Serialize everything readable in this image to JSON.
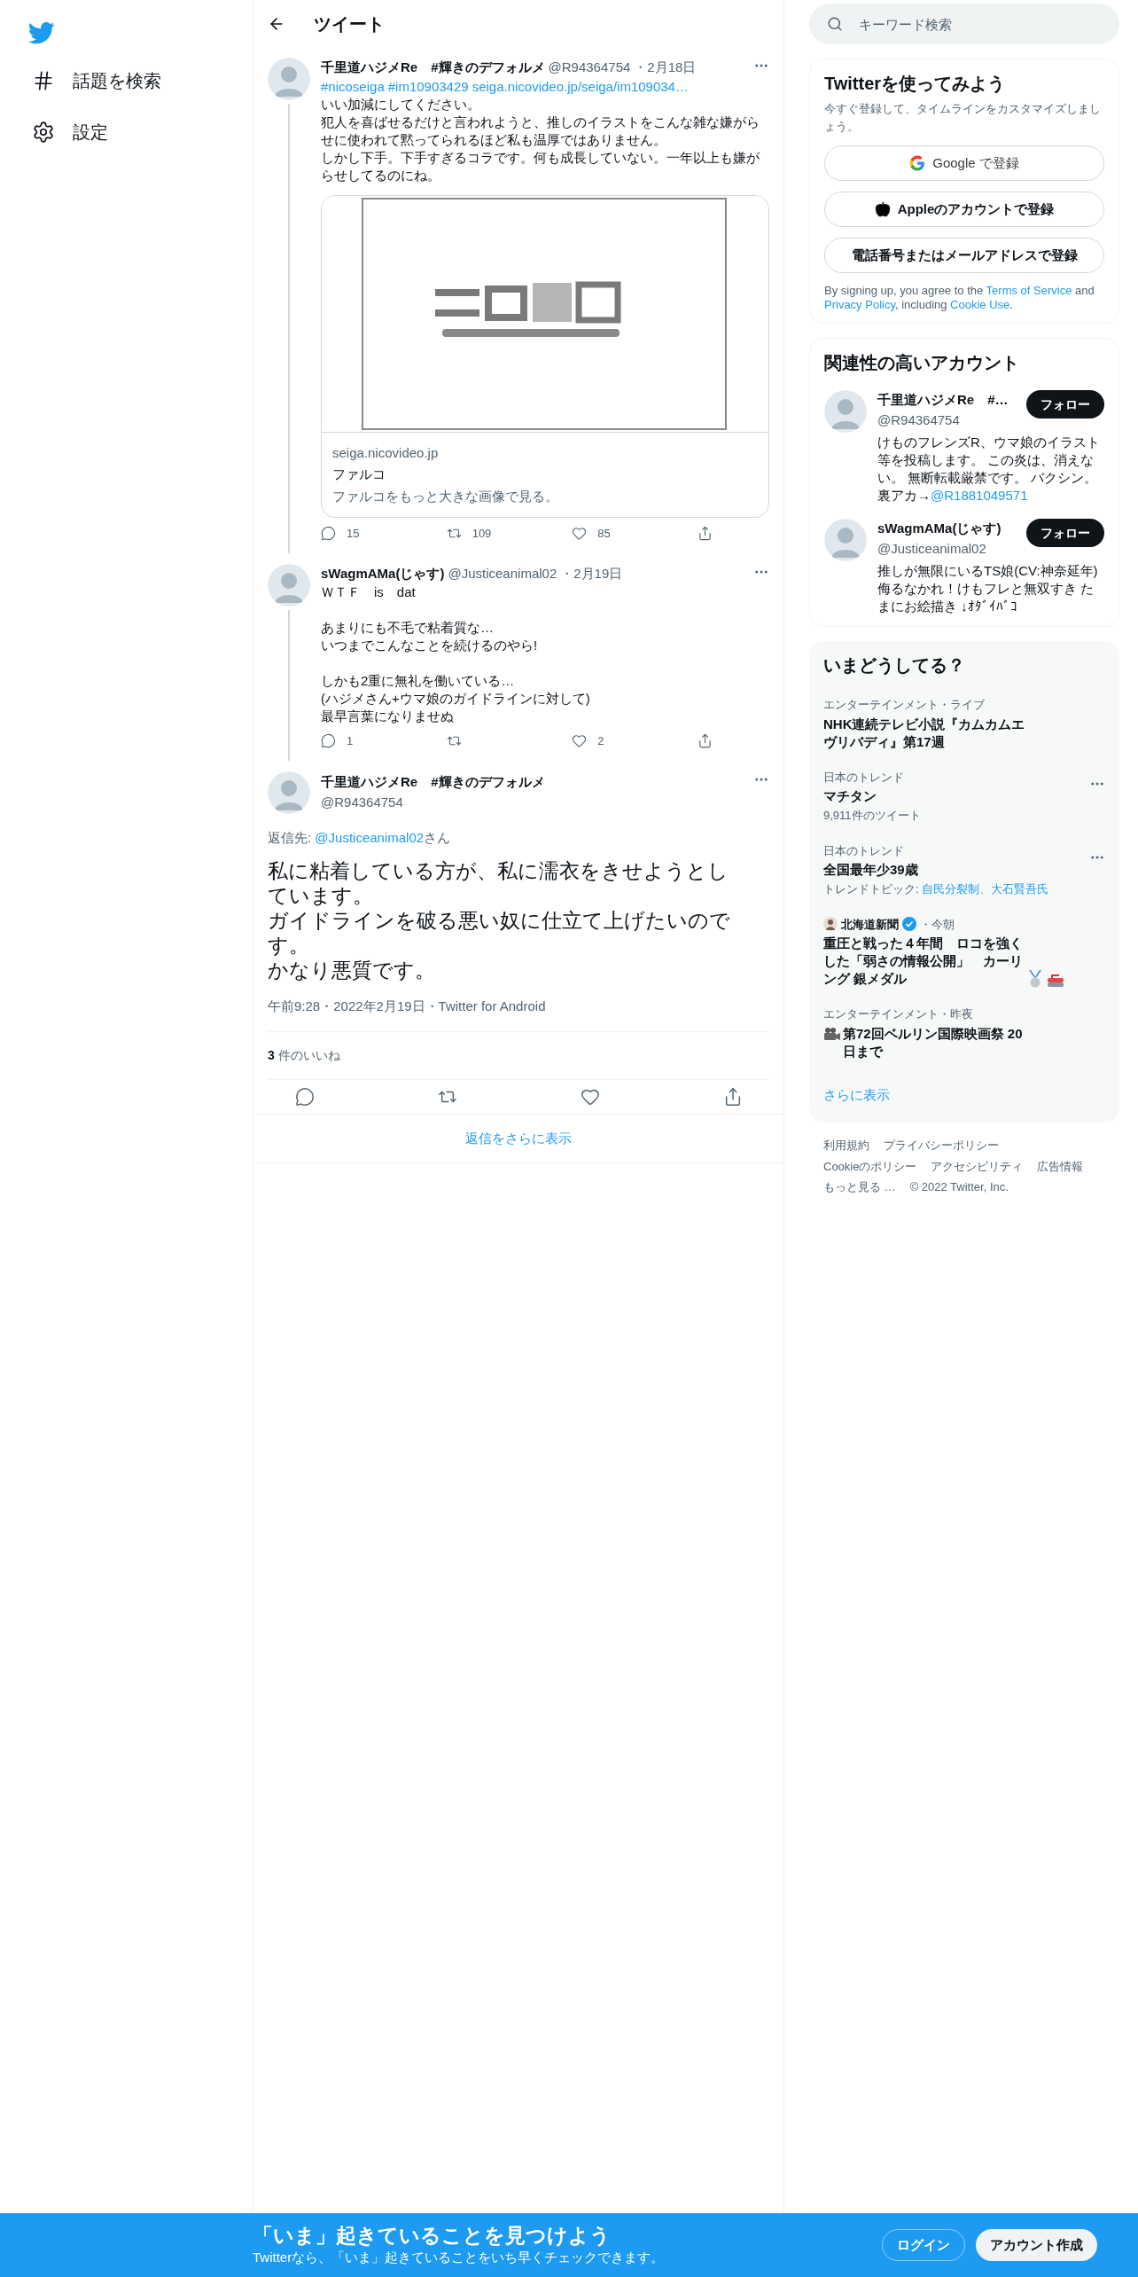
{
  "nav": {
    "items": [
      {
        "label": "話題を検索",
        "kind": "explore"
      },
      {
        "label": "設定",
        "kind": "settings"
      }
    ]
  },
  "header": {
    "title": "ツイート"
  },
  "thread": [
    {
      "name": "千里道ハジメRe　#輝きのデフォルメ",
      "handle": "@R94364754",
      "date": "・2月18日",
      "links": [
        "#nicoseiga",
        "#im10903429",
        "seiga.nicovideo.jp/seiga/im109034…"
      ],
      "paragraphs": [
        [
          "いい加減にしてください。",
          "犯人を喜ばせるだけと言われようと、推しのイラストをこんな雑な嫌がらせに使われて黙ってられるほど私も温厚ではありません。",
          "しかし下手。下手すぎるコラです。何も成長していない。一年以上も嫌がらせしてるのにね。"
        ]
      ],
      "card": {
        "domain": "seiga.nicovideo.jp",
        "title": "ファルコ",
        "description": "ファルコをもっと大きな画像で見る。"
      },
      "replies": "15",
      "retweets": "109",
      "likes": "85"
    },
    {
      "name": "sWagmAMa(じゃす)",
      "handle": "@Justiceanimal02",
      "date": "・2月19日",
      "paragraphs": [
        [
          "ＷＴＦ　is　dat"
        ],
        [
          "あまりにも不毛で粘着質な…",
          "いつまでこんなことを続けるのやら!"
        ],
        [
          "しかも2重に無礼を働いている…",
          "(ハジメさん+ウマ娘のガイドラインに対して)",
          "最早言葉になりませぬ"
        ]
      ],
      "replies": "1",
      "likes": "2"
    }
  ],
  "main_tweet": {
    "name": "千里道ハジメRe　#輝きのデフォルメ",
    "handle": "@R94364754",
    "reply_prefix": "返信先: ",
    "reply_to": "@Justiceanimal02",
    "reply_suffix": "さん",
    "lines": [
      "私に粘着している方が、私に濡衣をきせようとしています。",
      "ガイドラインを破る悪い奴に仕立て上げたいのです。",
      "かなり悪質です。"
    ],
    "meta": "午前9:28・2022年2月19日・Twitter for Android",
    "like_count": "3",
    "like_label": "件のいいね"
  },
  "show_more_replies": "返信をさらに表示",
  "search": {
    "placeholder": "キーワード検索"
  },
  "signup": {
    "title": "Twitterを使ってみよう",
    "subtitle": "今すぐ登録して、タイムラインをカスタマイズしましょう。",
    "buttons": [
      {
        "label": "Google で登録",
        "kind": "google"
      },
      {
        "label": "Appleのアカウントで登録",
        "kind": "apple"
      },
      {
        "label": "電話番号またはメールアドレスで登録",
        "kind": "plain"
      }
    ],
    "legal": [
      "By signing up, you agree to the ",
      "Terms of Service",
      " and ",
      "Privacy Policy",
      ", including ",
      "Cookie Use",
      "."
    ]
  },
  "related": {
    "title": "関連性の高いアカウント",
    "accounts": [
      {
        "name": "千里道ハジメRe　#…",
        "handle": "@R94364754",
        "bio": "けものフレンズR、ウマ娘のイラスト等を投稿します。 この炎は、消えない。 無断転載厳禁です。 バクシン。裏アカ→",
        "bio_link": "@R1881049571",
        "button": "フォロー"
      },
      {
        "name": "sWagmAMa(じゃす)",
        "handle": "@Justiceanimal02",
        "bio": "推しが無限にいるTS娘(CV:神奈延年) 侮るなかれ！けもフレと無双すき たまにお絵描き ↓ｵﾀﾞｲﾊﾞｺ",
        "button": "フォロー"
      }
    ]
  },
  "trends": {
    "title": "いまどうしてる？",
    "items": [
      {
        "kind": "event",
        "context": "エンターテインメント・ライブ",
        "title": "NHK連続テレビ小説『カムカムエヴリバディ』第17週"
      },
      {
        "kind": "trend",
        "context": "日本のトレンド",
        "title": "マチタン",
        "count": "9,911件のツイート"
      },
      {
        "kind": "trend",
        "context": "日本のトレンド",
        "title": "全国最年少39歳",
        "topic_label": "トレンドトピック: ",
        "topics": "自民分裂制、大石賢吾氏"
      },
      {
        "kind": "news",
        "source": "北海道新聞",
        "verified": true,
        "time": "・今朝",
        "title": "重圧と戦った４年間　ロコを強くした「弱さの情報公開」　カーリング 銀メダル"
      },
      {
        "kind": "film",
        "context": "エンターテインメント・昨夜",
        "title": "第72回ベルリン国際映画祭 20日まで"
      }
    ],
    "more": "さらに表示"
  },
  "footer": {
    "links": [
      "利用規約",
      "プライバシーポリシー",
      "Cookieのポリシー",
      "アクセシビリティ",
      "広告情報",
      "もっと見る …"
    ],
    "copyright": "© 2022 Twitter, Inc."
  },
  "banner": {
    "title": "「いま」起きていることを見つけよう",
    "subtitle": "Twitterなら、「いま」起きていることをいち早くチェックできます。",
    "login": "ログイン",
    "signup": "アカウント作成"
  }
}
